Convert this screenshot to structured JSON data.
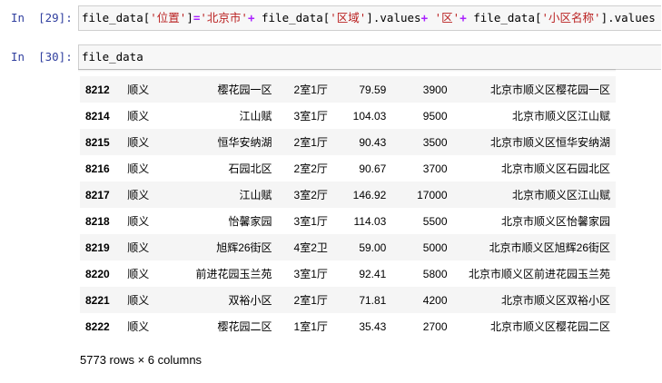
{
  "cells": [
    {
      "prompt": "In  [29]:",
      "code_tokens": [
        {
          "t": "file_data[",
          "k": "plain"
        },
        {
          "t": "'位置'",
          "k": "str"
        },
        {
          "t": "]",
          "k": "plain"
        },
        {
          "t": "=",
          "k": "op"
        },
        {
          "t": "'北京市'",
          "k": "str"
        },
        {
          "t": "+",
          "k": "op"
        },
        {
          "t": " file_data[",
          "k": "plain"
        },
        {
          "t": "'区域'",
          "k": "str"
        },
        {
          "t": "].values",
          "k": "plain"
        },
        {
          "t": "+",
          "k": "op"
        },
        {
          "t": " ",
          "k": "plain"
        },
        {
          "t": "'区'",
          "k": "str"
        },
        {
          "t": "+",
          "k": "op"
        },
        {
          "t": " file_data[",
          "k": "plain"
        },
        {
          "t": "'小区名称'",
          "k": "str"
        },
        {
          "t": "].values",
          "k": "plain"
        }
      ]
    },
    {
      "prompt": "In  [30]:",
      "code_tokens": [
        {
          "t": "file_data",
          "k": "plain"
        }
      ]
    }
  ],
  "dataframe": {
    "rows": [
      {
        "index": "8212",
        "district": "顺义",
        "name": "樱花园一区",
        "layout": "2室1厅",
        "area": "79.59",
        "price": "3900",
        "location": "北京市顺义区樱花园一区"
      },
      {
        "index": "8214",
        "district": "顺义",
        "name": "江山赋",
        "layout": "3室1厅",
        "area": "104.03",
        "price": "9500",
        "location": "北京市顺义区江山赋"
      },
      {
        "index": "8215",
        "district": "顺义",
        "name": "恒华安纳湖",
        "layout": "2室1厅",
        "area": "90.43",
        "price": "3500",
        "location": "北京市顺义区恒华安纳湖"
      },
      {
        "index": "8216",
        "district": "顺义",
        "name": "石园北区",
        "layout": "2室2厅",
        "area": "90.67",
        "price": "3700",
        "location": "北京市顺义区石园北区"
      },
      {
        "index": "8217",
        "district": "顺义",
        "name": "江山赋",
        "layout": "3室2厅",
        "area": "146.92",
        "price": "17000",
        "location": "北京市顺义区江山赋"
      },
      {
        "index": "8218",
        "district": "顺义",
        "name": "怡馨家园",
        "layout": "3室1厅",
        "area": "114.03",
        "price": "5500",
        "location": "北京市顺义区怡馨家园"
      },
      {
        "index": "8219",
        "district": "顺义",
        "name": "旭辉26街区",
        "layout": "4室2卫",
        "area": "59.00",
        "price": "5000",
        "location": "北京市顺义区旭辉26街区"
      },
      {
        "index": "8220",
        "district": "顺义",
        "name": "前进花园玉兰苑",
        "layout": "3室1厅",
        "area": "92.41",
        "price": "5800",
        "location": "北京市顺义区前进花园玉兰苑"
      },
      {
        "index": "8221",
        "district": "顺义",
        "name": "双裕小区",
        "layout": "2室1厅",
        "area": "71.81",
        "price": "4200",
        "location": "北京市顺义区双裕小区"
      },
      {
        "index": "8222",
        "district": "顺义",
        "name": "樱花园二区",
        "layout": "1室1厅",
        "area": "35.43",
        "price": "2700",
        "location": "北京市顺义区樱花园二区"
      }
    ],
    "shape_text": "5773 rows × 6 columns"
  },
  "colors": {
    "prompt": "#303f9f",
    "string": "#ba2121",
    "operator": "#aa22ff",
    "row_alt": "#f5f5f5"
  }
}
